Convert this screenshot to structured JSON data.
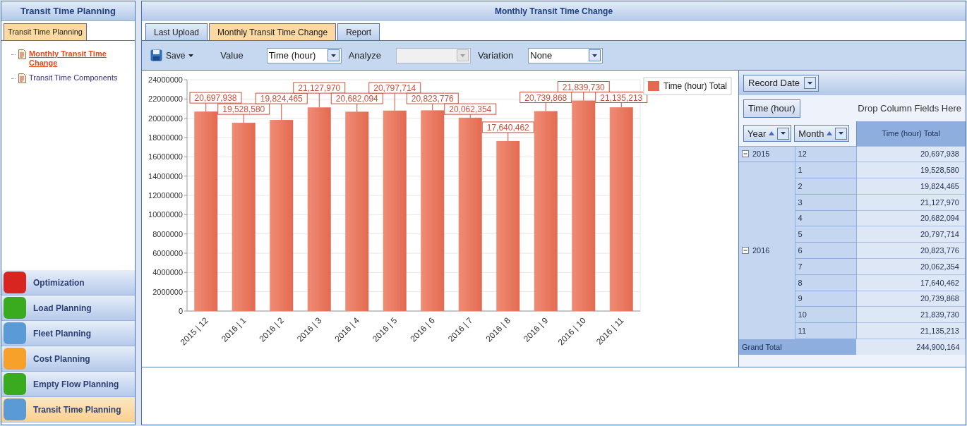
{
  "left_panel": {
    "title": "Transit Time Planning",
    "tabs": [
      {
        "label": "Transit Time Planning",
        "selected": true
      }
    ],
    "tree": [
      {
        "label": "Monthly Transit Time Change",
        "selected": true
      },
      {
        "label": "Transit Time Components",
        "selected": false
      }
    ]
  },
  "nav": [
    {
      "label": "Optimization",
      "color": "#d9251f",
      "selected": false
    },
    {
      "label": "Load Planning",
      "color": "#3aab1e",
      "selected": false
    },
    {
      "label": "Fleet Planning",
      "color": "#5b9bd5",
      "selected": false
    },
    {
      "label": "Cost Planning",
      "color": "#f7a12a",
      "selected": false
    },
    {
      "label": "Empty Flow Planning",
      "color": "#3aab1e",
      "selected": false
    },
    {
      "label": "Transit Time Planning",
      "color": "#5b9bd5",
      "selected": true
    }
  ],
  "main": {
    "title": "Monthly Transit Time Change",
    "tabs": [
      {
        "label": "Last Upload",
        "selected": false
      },
      {
        "label": "Monthly Transit Time Change",
        "selected": true
      },
      {
        "label": "Report",
        "selected": false
      }
    ],
    "toolbar": {
      "save": "Save",
      "fields": [
        {
          "label": "Value",
          "value": "Time (hour)",
          "disabled": false
        },
        {
          "label": "Analyze",
          "disabled": true
        },
        {
          "label": "Variation",
          "value": "None",
          "disabled": false
        }
      ]
    },
    "chart": {
      "chart_data": {
        "type": "bar",
        "categories": [
          "2015 | 12",
          "2016 | 1",
          "2016 | 2",
          "2016 | 3",
          "2016 | 4",
          "2016 | 5",
          "2016 | 6",
          "2016 | 7",
          "2016 | 8",
          "2016 | 9",
          "2016 | 10",
          "2016 | 11"
        ],
        "series": [
          {
            "name": "Time (hour) Total",
            "color": "#e46a52",
            "values": [
              20697938,
              19528580,
              19824465,
              21127970,
              20682094,
              20797714,
              20823776,
              20062354,
              17640462,
              20739868,
              21839730,
              21135213
            ]
          }
        ],
        "ylim": [
          0,
          24000000
        ],
        "yticks": [
          0,
          2000000,
          4000000,
          6000000,
          8000000,
          10000000,
          12000000,
          14000000,
          16000000,
          18000000,
          20000000,
          22000000,
          24000000
        ],
        "grid": true,
        "value_labels": [
          "20,697,938",
          "19,528,580",
          "19,824,465",
          "21,127,970",
          "20,682,094",
          "20,797,714",
          "20,823,776",
          "20,062,354",
          "17,640,462",
          "20,739,868",
          "21,839,730",
          "21,135,213"
        ]
      }
    },
    "pivot": {
      "filter_field": "Record Date",
      "data_field": "Time (hour)",
      "column_hint": "Drop Column Fields Here",
      "row_fields": [
        "Year",
        "Month"
      ],
      "column_header": "Time (hour) Total",
      "groups": [
        {
          "year": "2015",
          "expanded": true,
          "rows": [
            {
              "month": "12",
              "value": "20,697,938"
            }
          ]
        },
        {
          "year": "2016",
          "expanded": true,
          "rows": [
            {
              "month": "1",
              "value": "19,528,580"
            },
            {
              "month": "2",
              "value": "19,824,465"
            },
            {
              "month": "3",
              "value": "21,127,970"
            },
            {
              "month": "4",
              "value": "20,682,094"
            },
            {
              "month": "5",
              "value": "20,797,714"
            },
            {
              "month": "6",
              "value": "20,823,776"
            },
            {
              "month": "7",
              "value": "20,062,354"
            },
            {
              "month": "8",
              "value": "17,640,462"
            },
            {
              "month": "9",
              "value": "20,739,868"
            },
            {
              "month": "10",
              "value": "21,839,730"
            },
            {
              "month": "11",
              "value": "21,135,213"
            }
          ]
        }
      ],
      "grand_total": {
        "label": "Grand Total",
        "value": "244,900,164"
      }
    }
  }
}
